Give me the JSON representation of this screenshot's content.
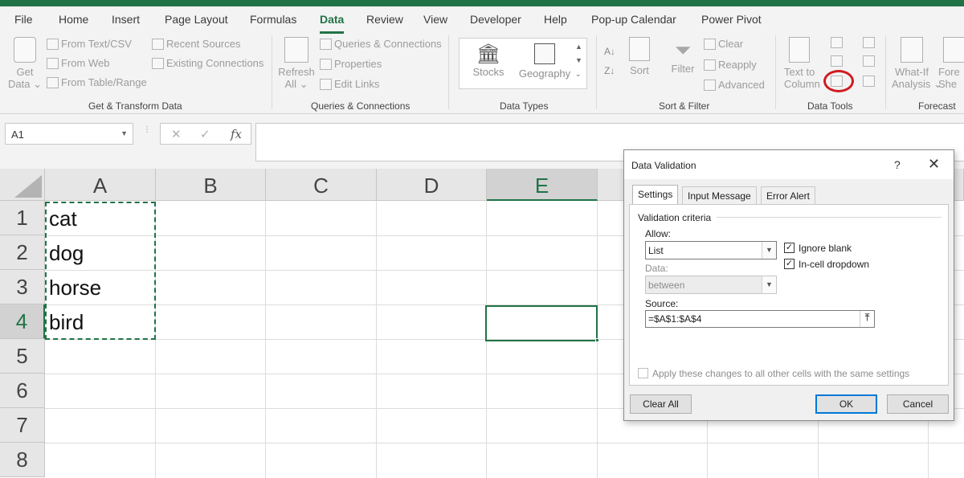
{
  "colors": {
    "accent": "#217346",
    "annotation_circle": "#d01c20",
    "dialog_default_border": "#0078d7"
  },
  "ribbon_tabs": [
    "File",
    "Home",
    "Insert",
    "Page Layout",
    "Formulas",
    "Data",
    "Review",
    "View",
    "Developer",
    "Help",
    "Pop-up Calendar",
    "Power Pivot"
  ],
  "active_tab": "Data",
  "ribbon": {
    "get_transform": {
      "get_data": "Get",
      "get_data2": "Data",
      "from_text_csv": "From Text/CSV",
      "from_web": "From Web",
      "from_table_range": "From Table/Range",
      "recent_sources": "Recent Sources",
      "existing_connections": "Existing Connections",
      "label": "Get & Transform Data"
    },
    "queries": {
      "refresh": "Refresh",
      "refresh_all": "All",
      "queries_connections": "Queries & Connections",
      "properties": "Properties",
      "edit_links": "Edit Links",
      "label": "Queries & Connections"
    },
    "data_types": {
      "stocks": "Stocks",
      "geography": "Geography",
      "label": "Data Types"
    },
    "sort_filter": {
      "sort": "Sort",
      "filter": "Filter",
      "clear": "Clear",
      "reapply": "Reapply",
      "advanced": "Advanced",
      "label": "Sort & Filter"
    },
    "data_tools": {
      "text_to": "Text to",
      "columns": "Column",
      "label": "Data Tools"
    },
    "forecast": {
      "what_if": "What-If",
      "analysis": "Analysis",
      "forecast_sheet_1": "Fore",
      "forecast_sheet_2": "She",
      "label": "Forecast"
    }
  },
  "formula_bar": {
    "name_box": "A1",
    "cancel_glyph": "✕",
    "enter_glyph": "✓",
    "fx": "fx",
    "formula": ""
  },
  "sheet": {
    "columns": [
      "A",
      "B",
      "C",
      "D",
      "E"
    ],
    "rows": [
      "1",
      "2",
      "3",
      "4",
      "5",
      "6",
      "7",
      "8"
    ],
    "cells": {
      "A1": "cat",
      "A2": "dog",
      "A3": "horse",
      "A4": "bird"
    }
  },
  "dialog": {
    "title": "Data Validation",
    "help": "?",
    "close": "✕",
    "tabs": [
      "Settings",
      "Input Message",
      "Error Alert"
    ],
    "validation_criteria": "Validation criteria",
    "allow_label": "Allow:",
    "allow_value": "List",
    "ignore_blank": "Ignore blank",
    "ignore_blank_checked": true,
    "in_cell_dropdown": "In-cell dropdown",
    "in_cell_dropdown_checked": true,
    "data_label": "Data:",
    "data_value": "between",
    "source_label": "Source:",
    "source_value": "=$A$1:$A$4",
    "apply_all": "Apply these changes to all other cells with the same settings",
    "clear_all": "Clear All",
    "ok": "OK",
    "cancel": "Cancel"
  }
}
